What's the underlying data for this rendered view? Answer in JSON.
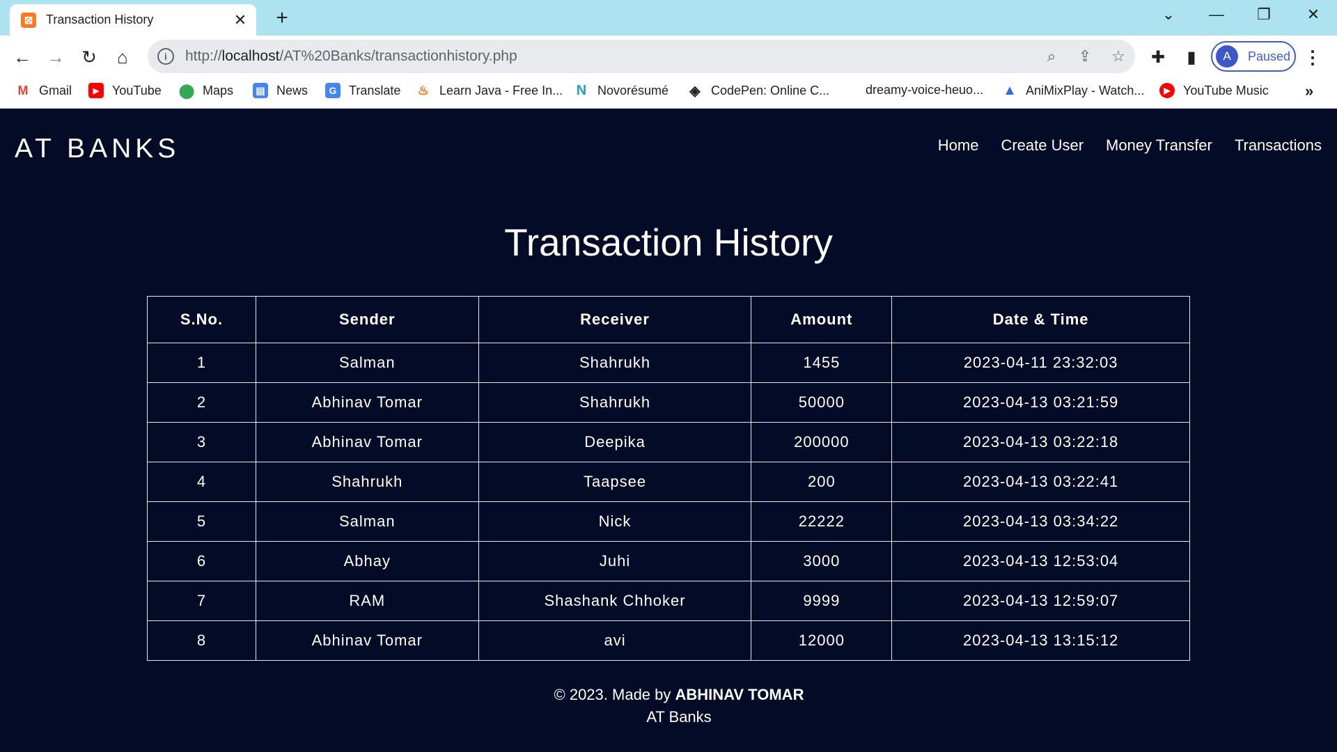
{
  "browser": {
    "tab_title": "Transaction History",
    "tab_favicon": "xampp-icon",
    "url_prefix": "http://",
    "url_host": "localhost",
    "url_path": "/AT%20Banks/transactionhistory.php",
    "profile_initial": "A",
    "profile_status": "Paused",
    "bookmarks": [
      {
        "label": "Gmail",
        "icon": "gmail-icon",
        "color": "#ea4335",
        "glyph": "M"
      },
      {
        "label": "YouTube",
        "icon": "youtube-icon",
        "color": "#ff0000",
        "glyph": "▶"
      },
      {
        "label": "Maps",
        "icon": "maps-icon",
        "color": "#34a853",
        "glyph": "●"
      },
      {
        "label": "News",
        "icon": "news-icon",
        "color": "#4285f4",
        "glyph": "▤"
      },
      {
        "label": "Translate",
        "icon": "translate-icon",
        "color": "#4285f4",
        "glyph": "G"
      },
      {
        "label": "Learn Java - Free In...",
        "icon": "java-icon",
        "color": "#e76f00",
        "glyph": "☕"
      },
      {
        "label": "Novorésumé",
        "icon": "novoresume-icon",
        "color": "#1aa1c8",
        "glyph": "N"
      },
      {
        "label": "CodePen: Online C...",
        "icon": "codepen-icon",
        "color": "#202124",
        "glyph": "◈"
      },
      {
        "label": "dreamy-voice-heuo...",
        "icon": "",
        "color": "",
        "glyph": ""
      },
      {
        "label": "AniMixPlay - Watch...",
        "icon": "animixplay-icon",
        "color": "#2d6cdf",
        "glyph": "A"
      },
      {
        "label": "YouTube Music",
        "icon": "youtube-music-icon",
        "color": "#ff0000",
        "glyph": "◉"
      }
    ]
  },
  "site": {
    "brand": "AT BANKS",
    "nav": [
      "Home",
      "Create User",
      "Money Transfer",
      "Transactions"
    ]
  },
  "page": {
    "title": "Transaction History",
    "columns": [
      "S.No.",
      "Sender",
      "Receiver",
      "Amount",
      "Date & Time"
    ],
    "rows": [
      [
        "1",
        "Salman",
        "Shahrukh",
        "1455",
        "2023-04-11 23:32:03"
      ],
      [
        "2",
        "Abhinav Tomar",
        "Shahrukh",
        "50000",
        "2023-04-13 03:21:59"
      ],
      [
        "3",
        "Abhinav Tomar",
        "Deepika",
        "200000",
        "2023-04-13 03:22:18"
      ],
      [
        "4",
        "Shahrukh",
        "Taapsee",
        "200",
        "2023-04-13 03:22:41"
      ],
      [
        "5",
        "Salman",
        "Nick",
        "22222",
        "2023-04-13 03:34:22"
      ],
      [
        "6",
        "Abhay",
        "Juhi",
        "3000",
        "2023-04-13 12:53:04"
      ],
      [
        "7",
        "RAM",
        "Shashank Chhoker",
        "9999",
        "2023-04-13 12:59:07"
      ],
      [
        "8",
        "Abhinav Tomar",
        "avi",
        "12000",
        "2023-04-13 13:15:12"
      ]
    ]
  },
  "footer": {
    "prefix": "© 2023. Made by ",
    "author": "ABHINAV TOMAR",
    "line2": "AT Banks"
  },
  "colors": {
    "page_bg": "#030b26",
    "tabstrip_bg": "#ade2f0",
    "profile_accent": "#3c5bd6"
  }
}
